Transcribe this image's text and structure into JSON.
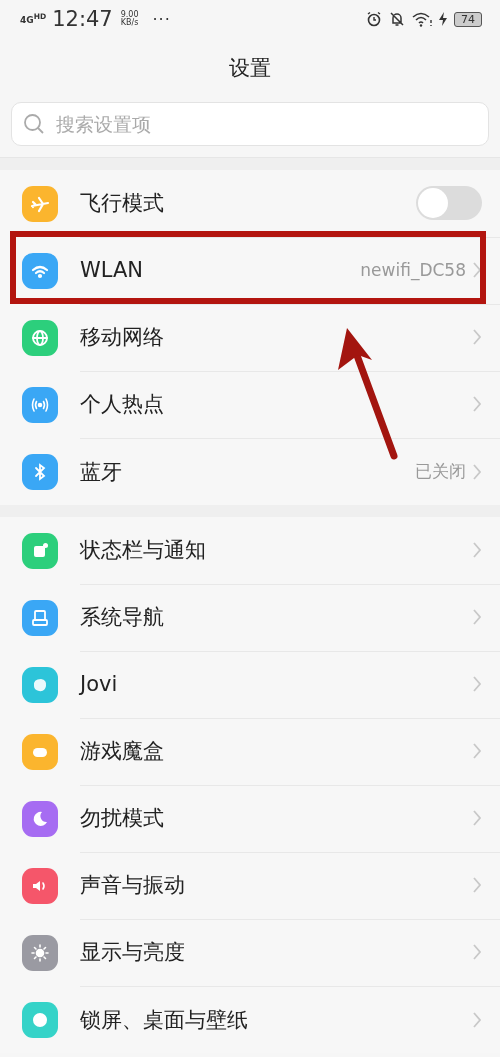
{
  "status_bar": {
    "network": "4G",
    "network_badge": "HD",
    "time": "12:47",
    "speed": "9.00",
    "speed_unit": "KB/s",
    "more": "···",
    "battery": "74"
  },
  "title": "设置",
  "search": {
    "placeholder": "搜索设置项"
  },
  "sections": [
    {
      "items": [
        {
          "kind": "toggle",
          "label": "飞行模式",
          "on": false,
          "color": "#fbb52e",
          "highlighted": false
        },
        {
          "kind": "link",
          "label": "WLAN",
          "value": "newifi_DC58",
          "color": "#3aa7f5",
          "highlighted": true
        },
        {
          "kind": "link",
          "label": "移动网络",
          "color": "#2ccf7c",
          "highlighted": false
        },
        {
          "kind": "link",
          "label": "个人热点",
          "color": "#3aa7f5",
          "highlighted": false
        },
        {
          "kind": "link",
          "label": "蓝牙",
          "value": "已关闭",
          "color": "#3aa7f5",
          "highlighted": false
        }
      ]
    },
    {
      "items": [
        {
          "kind": "link",
          "label": "状态栏与通知",
          "color": "#2ccf7c",
          "highlighted": false
        },
        {
          "kind": "link",
          "label": "系统导航",
          "color": "#3aa7f5",
          "highlighted": false
        },
        {
          "kind": "link",
          "label": "Jovi",
          "color": "#2cc4d9",
          "highlighted": false
        },
        {
          "kind": "link",
          "label": "游戏魔盒",
          "color": "#fbb52e",
          "highlighted": false
        },
        {
          "kind": "link",
          "label": "勿扰模式",
          "color": "#a66cf2",
          "highlighted": false
        },
        {
          "kind": "link",
          "label": "声音与振动",
          "color": "#f5566a",
          "highlighted": false
        },
        {
          "kind": "link",
          "label": "显示与亮度",
          "color": "#9a9aa2",
          "highlighted": false
        },
        {
          "kind": "link",
          "label": "锁屏、桌面与壁纸",
          "color": "#35d3c8",
          "highlighted": false
        }
      ]
    }
  ]
}
